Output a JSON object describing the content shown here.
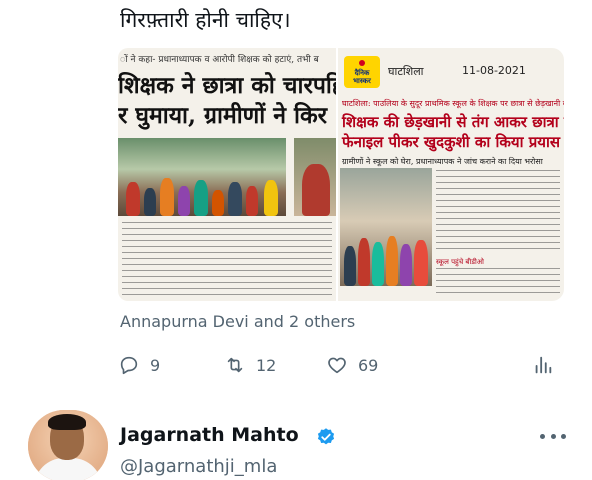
{
  "tweet": {
    "text_line": "गिरफ़्तारी होनी चाहिए।"
  },
  "media": {
    "left_clip": {
      "kicker": "ों ने कहा- प्रधानाध्यापक व आरोपी शिक्षक को हटाएं, तभी ब",
      "headline_line1": "शिक्षक ने छात्रा को चारपहि",
      "headline_line2": "र घुमाया, ग्रामीणों ने किर"
    },
    "right_clip": {
      "masthead": "दैनिक भास्कर",
      "place": "घाटशिला",
      "date": "11-08-2021",
      "kicker": "घाटशिला: पाउलिया के सुदूर प्राथमिक स्कूल के शिक्षक पर छात्रा से छेड़खानी का आरोप",
      "headline_line1": "शिक्षक की छेड़खानी से तंग आकर छात्रा ने",
      "headline_line2": "फेनाइल पीकर खुदकुशी का किया प्रयास",
      "caption": "ग्रामीणों ने स्कूल को घेरा, प्रधानाध्यापक ने जांच कराने का दिया भरोसा",
      "sub_caption": "स्कूल पहुंचे बीडीओ"
    }
  },
  "engagement": {
    "liked_by": "Annapurna Devi and 2 others",
    "reply_count": "9",
    "retweet_count": "12",
    "like_count": "69"
  },
  "author": {
    "name": "Jagarnath Mahto",
    "handle": "@Jagarnathji_mla"
  },
  "icons": {
    "reply": "reply-icon",
    "retweet": "retweet-icon",
    "like": "heart-icon",
    "analytics": "analytics-icon",
    "verified": "verified-badge-icon",
    "more": "more-options-icon"
  },
  "colors": {
    "text_primary": "#0f1419",
    "text_secondary": "#536471",
    "verified_blue": "#1d9bf0",
    "headline_red": "#b3001b",
    "masthead_yellow": "#ffd400"
  }
}
